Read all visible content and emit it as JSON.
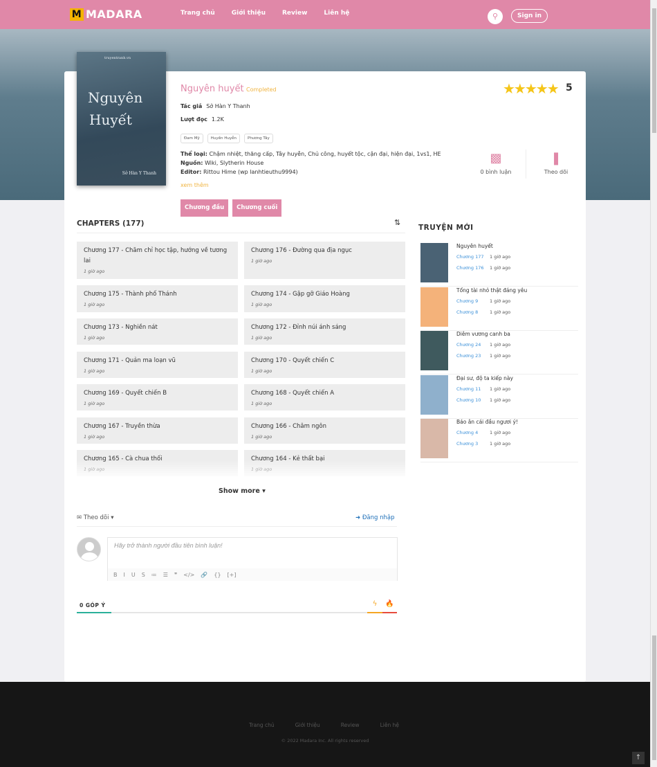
{
  "header": {
    "logo": "MADARA",
    "logo_mark": "M",
    "nav": [
      "Trang chủ",
      "Giới thiệu",
      "Review",
      "Liên hệ"
    ],
    "signin": "Sign in"
  },
  "manga": {
    "cover_title_1": "Nguyên",
    "cover_title_2": "Huyết",
    "cover_top": "truyentranh.vn",
    "cover_author": "Sở Hàn Y Thanh",
    "title": "Nguyên huyết",
    "status": "Completed",
    "author_label": "Tác giả",
    "author": "Sở Hàn Y Thanh",
    "views_label": "Lượt đọc",
    "views": "1.2K",
    "tags": [
      "Đam Mỹ",
      "Huyền Huyễn",
      "Phương Tây"
    ],
    "genre_label": "Thể loại:",
    "genre": "Chậm nhiệt, thăng cấp, Tây huyễn, Chủ công, huyết tộc, cận đại, hiện đại, 1vs1, HE",
    "source_label": "Nguồn:",
    "source": "Wiki, Slytherin House",
    "editor_label": "Editor:",
    "editor": "Rittou Hime (wp lanhtieuthu9994)",
    "more": "xem thêm",
    "first_btn": "Chương đầu",
    "last_btn": "Chương cuối",
    "rating": "5",
    "rating_fraction": 1.0,
    "comments": "0 bình luận",
    "follow": "Theo dõi",
    "accent": "#e088a8"
  },
  "chapters": {
    "heading": "CHAPTERS (177)",
    "show_more": "Show more",
    "items": [
      {
        "name": "Chương 177 - Chăm chỉ học tập, hướng về tương lai",
        "date": "1 giờ ago"
      },
      {
        "name": "Chương 176 - Đường qua địa ngục",
        "date": "1 giờ ago"
      },
      {
        "name": "Chương 175 - Thành phố Thánh",
        "date": "1 giờ ago"
      },
      {
        "name": "Chương 174 - Gặp gỡ Giáo Hoàng",
        "date": "1 giờ ago"
      },
      {
        "name": "Chương 173 - Nghiền nát",
        "date": "1 giờ ago"
      },
      {
        "name": "Chương 172 - Đỉnh núi ánh sáng",
        "date": "1 giờ ago"
      },
      {
        "name": "Chương 171 - Quản ma loạn vũ",
        "date": "1 giờ ago"
      },
      {
        "name": "Chương 170 - Quyết chiến C",
        "date": "1 giờ ago"
      },
      {
        "name": "Chương 169 - Quyết chiến B",
        "date": "1 giờ ago"
      },
      {
        "name": "Chương 168 - Quyết chiến A",
        "date": "1 giờ ago"
      },
      {
        "name": "Chương 167 - Truyền thừa",
        "date": "1 giờ ago"
      },
      {
        "name": "Chương 166 - Châm ngôn",
        "date": "1 giờ ago"
      },
      {
        "name": "Chương 165 - Cà chua thối",
        "date": "1 giờ ago"
      },
      {
        "name": "Chương 164 - Kẻ thất bại",
        "date": "1 giờ ago"
      }
    ]
  },
  "comments": {
    "follow": "Theo dõi",
    "login": "Đăng nhập",
    "placeholder": "Hãy trở thành người đầu tiên bình luận!",
    "toolbar": [
      "B",
      "I",
      "U",
      "S",
      "≔",
      "☰",
      "❞",
      "</>",
      "🔗",
      "{}",
      "[+]"
    ],
    "count": "0 GÓP Ý"
  },
  "sidebar": {
    "title": "TRUYỆN MỚI",
    "items": [
      {
        "name": "Nguyên huyết",
        "c1": "Chương 177",
        "t1": "1 giờ ago",
        "c2": "Chương 176",
        "t2": "1 giờ ago",
        "color": "#4a6274"
      },
      {
        "name": "Tổng tài nhỏ thật đáng yêu",
        "c1": "Chương 9",
        "t1": "1 giờ ago",
        "c2": "Chương 8",
        "t2": "1 giờ ago",
        "color": "#f4b27a"
      },
      {
        "name": "Diêm vương canh ba",
        "c1": "Chương 24",
        "t1": "1 giờ ago",
        "c2": "Chương 23",
        "t2": "1 giờ ago",
        "color": "#3f5a5e"
      },
      {
        "name": "Đại sư, độ ta kiếp này",
        "c1": "Chương 11",
        "t1": "1 giờ ago",
        "c2": "Chương 10",
        "t2": "1 giờ ago",
        "color": "#8fb0cc"
      },
      {
        "name": "Báo ân cái đầu ngươi ý!",
        "c1": "Chương 4",
        "t1": "1 giờ ago",
        "c2": "Chương 3",
        "t2": "1 giờ ago",
        "color": "#d9b8a8"
      }
    ]
  },
  "footer": {
    "nav": [
      "Trang chủ",
      "Giới thiệu",
      "Review",
      "Liên hệ"
    ],
    "copyright": "© 2022 Madara Inc. All rights reserved"
  }
}
